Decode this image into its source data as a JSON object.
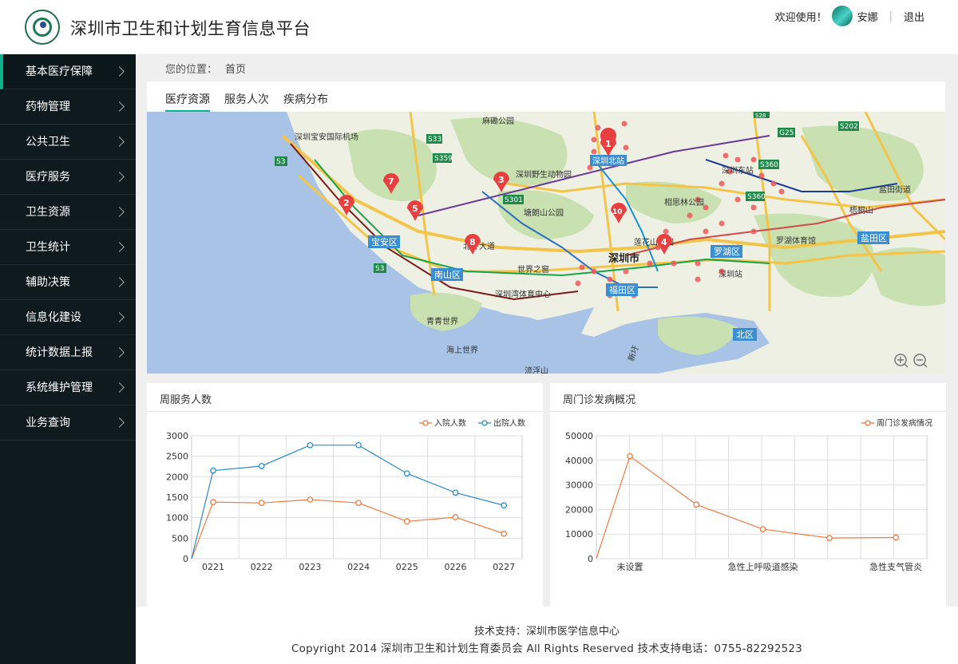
{
  "header": {
    "site_title": "深圳市卫生和计划生育信息平台",
    "welcome": "欢迎使用！",
    "username": "安娜",
    "logout": "退出"
  },
  "sidebar": {
    "items": [
      {
        "label": "基本医疗保障"
      },
      {
        "label": "药物管理"
      },
      {
        "label": "公共卫生"
      },
      {
        "label": "医疗服务"
      },
      {
        "label": "卫生资源"
      },
      {
        "label": "卫生统计"
      },
      {
        "label": "辅助决策"
      },
      {
        "label": "信息化建设"
      },
      {
        "label": "统计数据上报"
      },
      {
        "label": "系统维护管理"
      },
      {
        "label": "业务查询"
      }
    ]
  },
  "breadcrumb": {
    "label": "您的位置：",
    "current": "首页"
  },
  "tabs": [
    {
      "label": "医疗资源"
    },
    {
      "label": "服务人次"
    },
    {
      "label": "疾病分布"
    }
  ],
  "map": {
    "labels": {
      "airport": "深圳宝安国际机场",
      "mahi": "麻磡公园",
      "shenzhen_north": "深圳北站",
      "zoo": "深圳野生动物园",
      "tanglang": "塘朗山公园",
      "xiangsi": "相思林公园",
      "shenzhen_east": "深圳东站",
      "baoan": "宝安区",
      "nanshan": "南山区",
      "futian": "福田区",
      "luohu": "罗湖区",
      "yantian": "盐田区",
      "bei": "北区",
      "shenzhen_city": "深圳市",
      "lianhua": "莲花山公园",
      "window": "世界之窗",
      "bay_sports": "深圳湾体育中心",
      "qingqing": "青青世界",
      "haishang": "海上世界",
      "shenzhen_station": "深圳站",
      "luohu_sports": "罗湖体育馆",
      "wutong": "梧桐山",
      "yantian_street": "盐田街道",
      "beihuan": "北环大道",
      "liufushan": "流浮山",
      "s33": "S33",
      "s3": "S3",
      "s359": "S359",
      "s301": "S301",
      "s360": "S360",
      "g25": "G25",
      "s202": "S202",
      "s28": "S28",
      "binhai": "新圩",
      "xinqiu": "新"
    },
    "markers": [
      "1",
      "2",
      "3",
      "4",
      "5",
      "7",
      "8",
      "10"
    ]
  },
  "chart_left": {
    "title": "周服务人数",
    "chart_data": {
      "type": "line",
      "categories": [
        "0221",
        "0222",
        "0223",
        "0224",
        "0225",
        "0226",
        "0227"
      ],
      "series": [
        {
          "name": "入院人数",
          "values": [
            1380,
            1360,
            1440,
            1360,
            910,
            1010,
            610
          ],
          "color": "#ee7a3f"
        },
        {
          "name": "出院人数",
          "values": [
            2150,
            2260,
            2770,
            2770,
            2080,
            1610,
            1300
          ],
          "color": "#2b8bc6"
        }
      ],
      "ylim": [
        0,
        3000
      ],
      "yticks": [
        "0",
        "500",
        "1000",
        "1500",
        "2000",
        "2500",
        "3000"
      ],
      "grid": true,
      "legend": "top-right"
    }
  },
  "chart_right": {
    "title": "周门诊发病概况",
    "chart_data": {
      "type": "line",
      "categories": [
        "未设置",
        "",
        "急性上呼吸道感染",
        "",
        "急性支气管炎"
      ],
      "series": [
        {
          "name": "周门诊发病情况",
          "values": [
            41700,
            22000,
            12000,
            8400,
            8600
          ],
          "color": "#ee7a3f"
        }
      ],
      "ylim": [
        0,
        50000
      ],
      "yticks": [
        "0",
        "10000",
        "20000",
        "30000",
        "40000",
        "50000"
      ],
      "grid": true,
      "legend": "top-right"
    }
  },
  "footer": {
    "line1": "技术支持：深圳市医学信息中心",
    "line2": "Copyright 2014 深圳市卫生和计划生育委员会 All Rights Reserved 技术支持电话：0755-82292523"
  }
}
